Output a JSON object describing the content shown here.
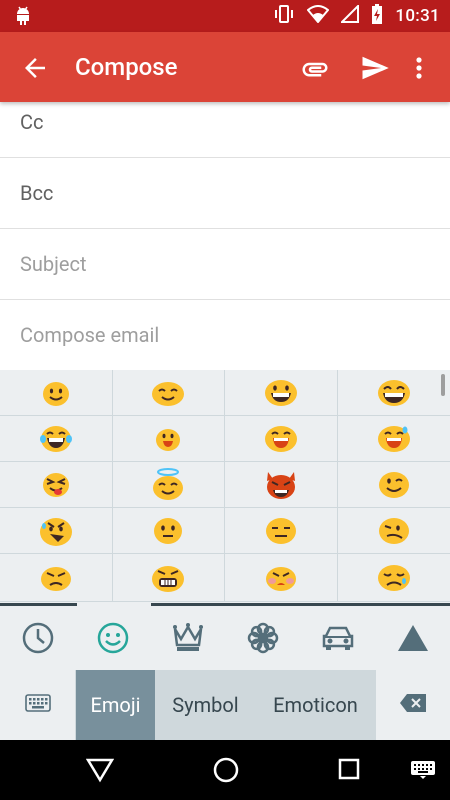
{
  "status_bar": {
    "time": "10:31"
  },
  "app_bar": {
    "title": "Compose"
  },
  "fields": {
    "cc_label": "Cc",
    "bcc_label": "Bcc",
    "subject_placeholder": "Subject",
    "body_placeholder": "Compose email"
  },
  "emoji_panel": {
    "emojis": [
      "slightly-smiling-face",
      "smiling-face",
      "grinning-face",
      "grinning-squinting-face",
      "tears-of-joy-face",
      "smile-open-face",
      "laughing-face",
      "sweat-smile-face",
      "squinting-tongue-face",
      "smiling-face-with-halo",
      "smiling-face-with-horns",
      "winking-face",
      "nervous-face",
      "neutral-face",
      "expressionless-face",
      "confused-face",
      "angry-face",
      "grimacing-face",
      "pouting-face",
      "sad-face"
    ],
    "categories": [
      "recent-clock-icon",
      "smiley-icon",
      "crown-icon",
      "flower-icon",
      "car-icon",
      "triangle-icon"
    ],
    "active_category": "smiley-icon",
    "bottom_row": {
      "emoji_label": "Emoji",
      "symbol_label": "Symbol",
      "emoticon_label": "Emoticon"
    }
  },
  "colors": {
    "status_bar": "#b71c1c",
    "app_bar": "#db4437",
    "emoji_yellow": "#fbc02d",
    "devil_red": "#d84315",
    "active_tab_teal": "#26a69a",
    "active_key": "#78909c"
  }
}
